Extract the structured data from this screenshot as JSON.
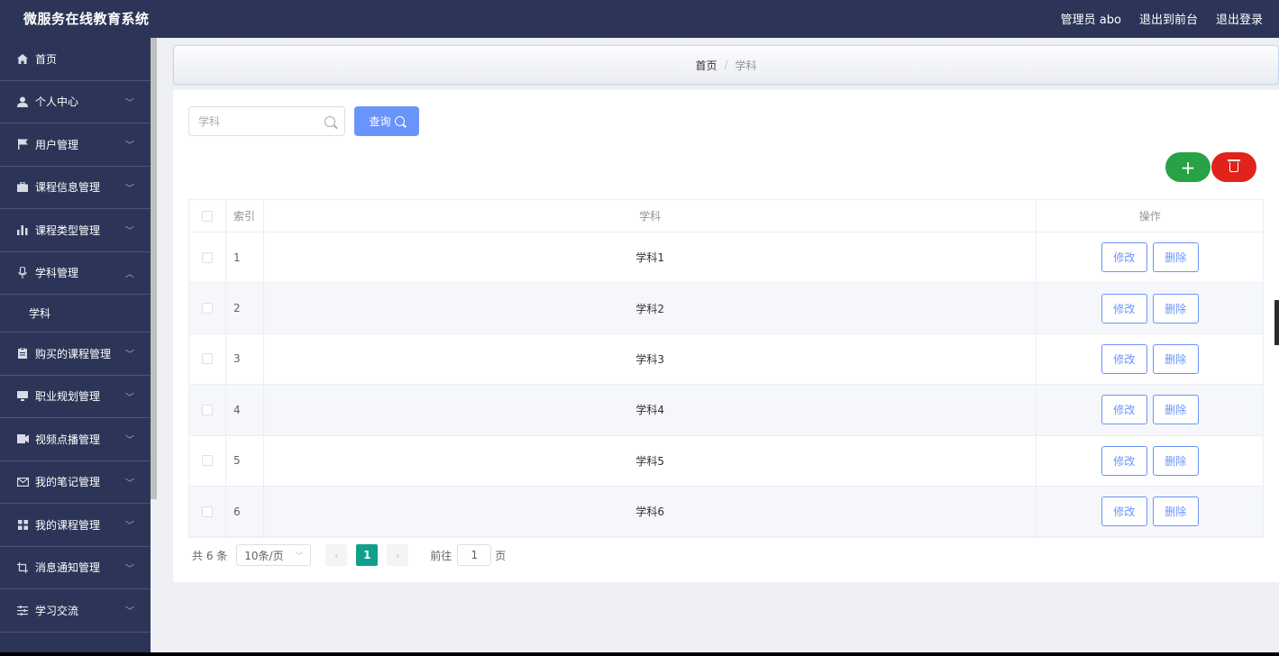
{
  "app": {
    "title": "微服务在线教育系统"
  },
  "header": {
    "user_label": "管理员 abo",
    "front_link": "退出到前台",
    "logout_link": "退出登录"
  },
  "sidebar": {
    "items": [
      {
        "label": "首页",
        "icon": "home-icon",
        "has_chevron": false
      },
      {
        "label": "个人中心",
        "icon": "user-icon",
        "has_chevron": true
      },
      {
        "label": "用户管理",
        "icon": "flag-icon",
        "has_chevron": true
      },
      {
        "label": "课程信息管理",
        "icon": "briefcase-icon",
        "has_chevron": true
      },
      {
        "label": "课程类型管理",
        "icon": "bar-chart-icon",
        "has_chevron": true
      },
      {
        "label": "学科管理",
        "icon": "mic-icon",
        "has_chevron": true,
        "expanded": true
      },
      {
        "label": "学科",
        "submenu": true
      },
      {
        "label": "购买的课程管理",
        "icon": "clipboard-icon",
        "has_chevron": true
      },
      {
        "label": "职业规划管理",
        "icon": "monitor-icon",
        "has_chevron": true
      },
      {
        "label": "视频点播管理",
        "icon": "video-icon",
        "has_chevron": true
      },
      {
        "label": "我的笔记管理",
        "icon": "mail-icon",
        "has_chevron": true
      },
      {
        "label": "我的课程管理",
        "icon": "grid-icon",
        "has_chevron": true
      },
      {
        "label": "消息通知管理",
        "icon": "crop-icon",
        "has_chevron": true
      },
      {
        "label": "学习交流",
        "icon": "sliders-icon",
        "has_chevron": true
      }
    ]
  },
  "breadcrumb": {
    "home": "首页",
    "separator": "/",
    "current": "学科"
  },
  "search": {
    "placeholder": "学科",
    "button_label": "查询"
  },
  "table": {
    "headers": {
      "index": "索引",
      "subject": "学科",
      "actions": "操作"
    },
    "rows": [
      {
        "index": "1",
        "subject": "学科1"
      },
      {
        "index": "2",
        "subject": "学科2"
      },
      {
        "index": "3",
        "subject": "学科3"
      },
      {
        "index": "4",
        "subject": "学科4"
      },
      {
        "index": "5",
        "subject": "学科5"
      },
      {
        "index": "6",
        "subject": "学科6"
      }
    ],
    "edit_label": "修改",
    "delete_label": "删除"
  },
  "pagination": {
    "total": "共 6 条",
    "page_size": "10条/页",
    "current_page": "1",
    "goto_label": "前往",
    "goto_value": "1",
    "page_suffix": "页"
  },
  "colors": {
    "sidebar_bg": "#2c3557",
    "primary": "#6a93fb",
    "add": "#27a244",
    "delete": "#e0241d",
    "page_active": "#0ea08b"
  }
}
